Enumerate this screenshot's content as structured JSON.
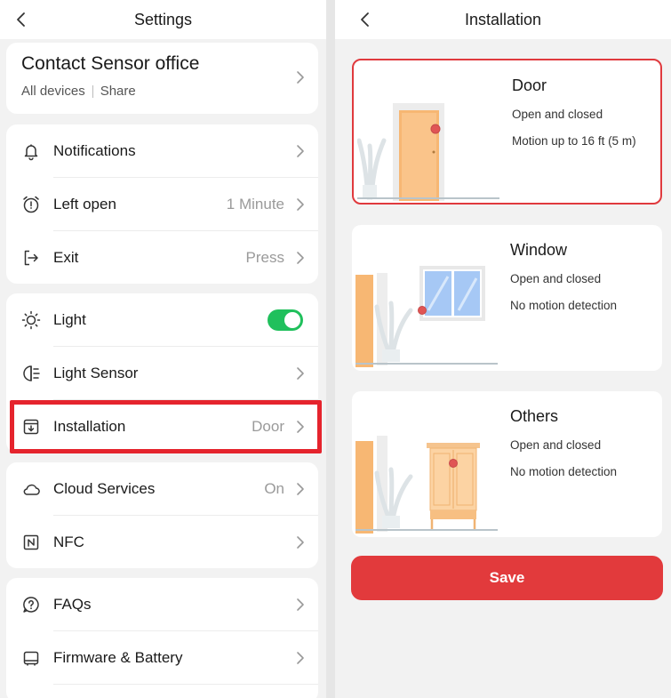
{
  "left": {
    "title": "Settings",
    "device": {
      "name": "Contact Sensor office",
      "link1": "All devices",
      "link2": "Share"
    },
    "rows": [
      {
        "label": "Notifications",
        "value": ""
      },
      {
        "label": "Left open",
        "value": "1 Minute"
      },
      {
        "label": "Exit",
        "value": "Press"
      },
      {
        "label": "Light",
        "value": ""
      },
      {
        "label": "Light Sensor",
        "value": ""
      },
      {
        "label": "Installation",
        "value": "Door"
      },
      {
        "label": "Cloud Services",
        "value": "On"
      },
      {
        "label": "NFC",
        "value": ""
      },
      {
        "label": "FAQs",
        "value": ""
      },
      {
        "label": "Firmware & Battery",
        "value": ""
      }
    ],
    "light_toggle": "on"
  },
  "right": {
    "title": "Installation",
    "options": [
      {
        "name": "Door",
        "line1": "Open and closed",
        "line2": "Motion up to 16 ft (5 m)",
        "selected": true
      },
      {
        "name": "Window",
        "line1": "Open and closed",
        "line2": "No motion detection",
        "selected": false
      },
      {
        "name": "Others",
        "line1": "Open and closed",
        "line2": "No motion detection",
        "selected": false
      }
    ],
    "save_label": "Save"
  },
  "colors": {
    "accent": "#e23a3c",
    "toggle": "#20c05c",
    "selection": "#e03a3e"
  }
}
